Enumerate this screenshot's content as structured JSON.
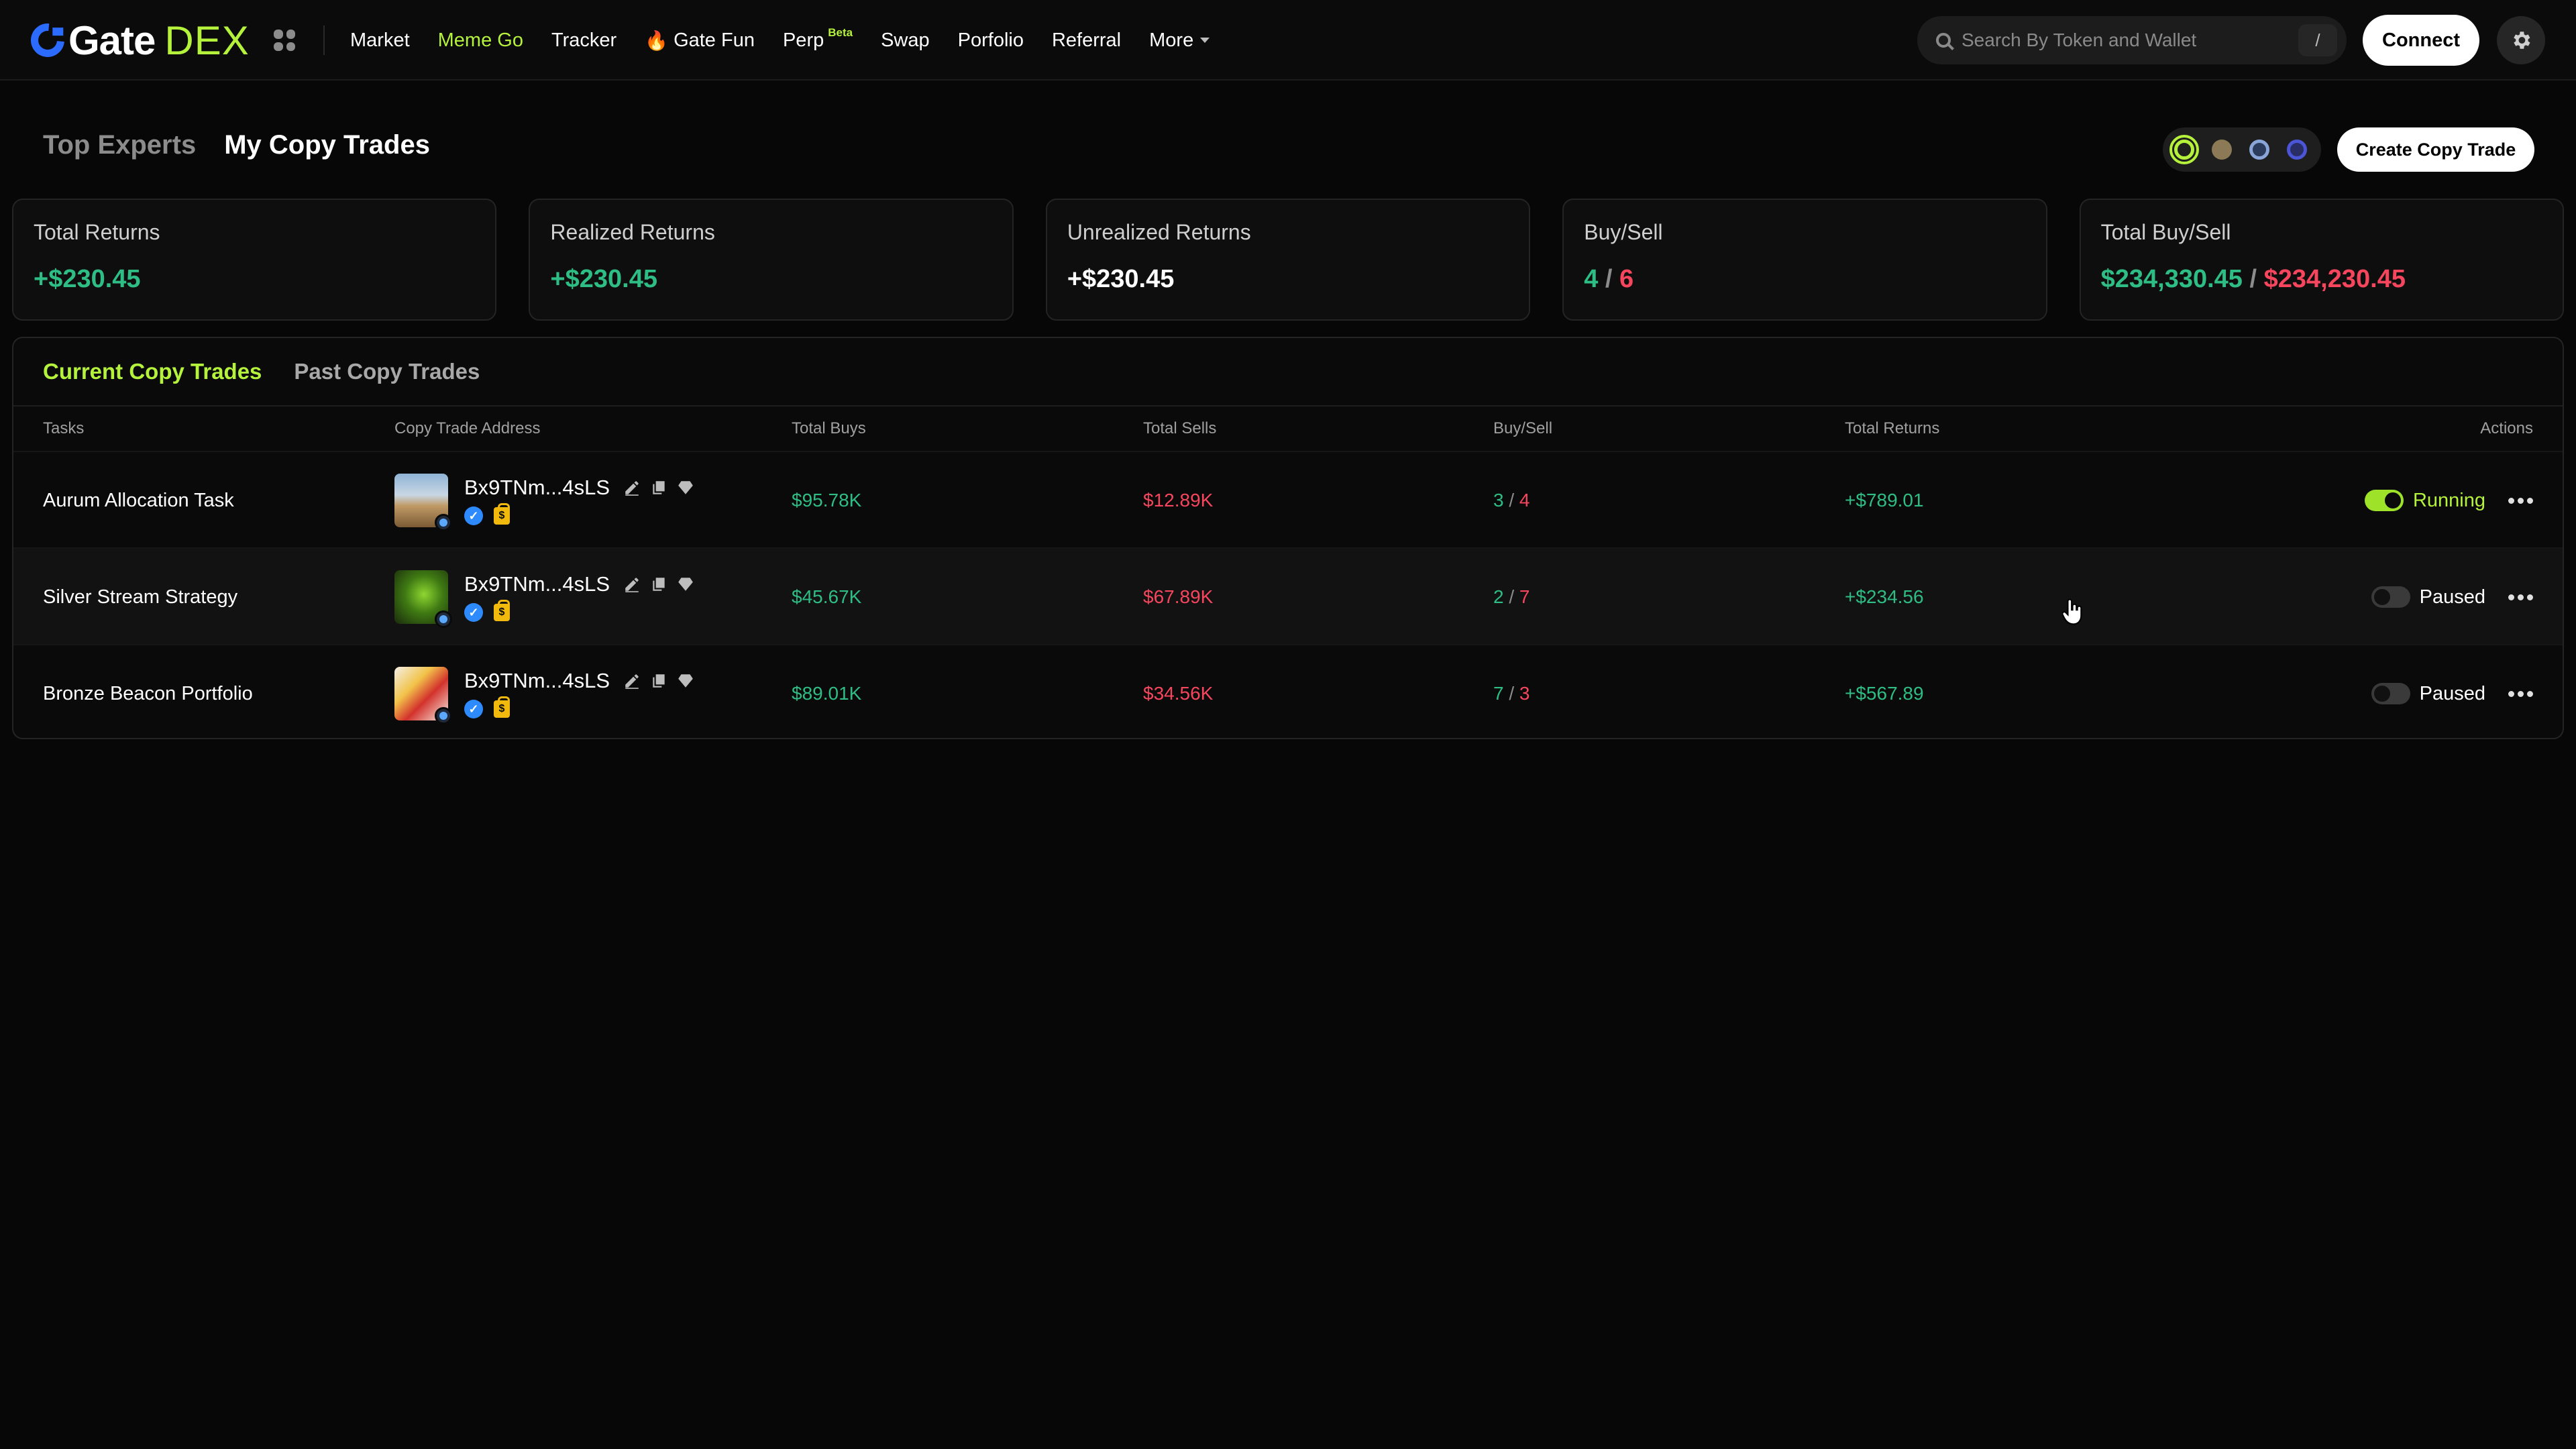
{
  "header": {
    "logo_gate": "Gate",
    "logo_dex": "DEX",
    "nav": [
      {
        "label": "Market",
        "active": false
      },
      {
        "label": "Meme Go",
        "active": true
      },
      {
        "label": "Tracker",
        "active": false
      },
      {
        "label": "Gate Fun",
        "active": false,
        "icon": "fire-icon"
      },
      {
        "label": "Perp",
        "active": false,
        "badge": "Beta"
      },
      {
        "label": "Swap",
        "active": false
      },
      {
        "label": "Porfolio",
        "active": false
      },
      {
        "label": "Referral",
        "active": false
      },
      {
        "label": "More",
        "active": false,
        "icon": "caret-down-icon"
      }
    ],
    "search_placeholder": "Search By Token and Wallet",
    "search_shortcut": "/",
    "connect_label": "Connect",
    "settings_icon": "gear-icon"
  },
  "page_tabs": [
    {
      "label": "Top Experts",
      "active": false
    },
    {
      "label": "My Copy Trades",
      "active": true
    }
  ],
  "chain_selector": {
    "chains": [
      {
        "icon": "solana-icon",
        "color": "#b5f23c",
        "selected": true
      },
      {
        "icon": "bnb-icon",
        "color": "#8b7a55",
        "selected": false
      },
      {
        "icon": "base-icon",
        "color": "#8aa6d8",
        "selected": false
      },
      {
        "icon": "ethereum-icon",
        "color": "#4a56d6",
        "selected": false
      }
    ]
  },
  "create_button_label": "Create Copy Trade",
  "stats": {
    "total_returns": {
      "label": "Total Returns",
      "value": "+$230.45"
    },
    "realized_returns": {
      "label": "Realized Returns",
      "value": "+$230.45"
    },
    "unrealized_returns": {
      "label": "Unrealized Returns",
      "value": "+$230.45"
    },
    "buy_sell": {
      "label": "Buy/Sell",
      "buy": "4",
      "sep": " / ",
      "sell": "6"
    },
    "total_buy_sell": {
      "label": "Total Buy/Sell",
      "buy": "$234,330.45",
      "sep": " / ",
      "sell": "$234,230.45"
    }
  },
  "sub_tabs": [
    {
      "label": "Current Copy Trades",
      "active": true
    },
    {
      "label": "Past Copy Trades",
      "active": false
    }
  ],
  "table": {
    "columns": [
      "Tasks",
      "Copy Trade Address",
      "Total Buys",
      "Total Sells",
      "Buy/Sell",
      "Total Returns",
      "Actions"
    ],
    "rows": [
      {
        "task": "Aurum Allocation Task",
        "address": "Bx9TNm...4sLS",
        "total_buys": "$95.78K",
        "total_sells": "$12.89K",
        "buys": "3",
        "sells": "4",
        "total_returns": "+$789.01",
        "status": "Running",
        "enabled": true
      },
      {
        "task": "Silver Stream Strategy",
        "address": "Bx9TNm...4sLS",
        "total_buys": "$45.67K",
        "total_sells": "$67.89K",
        "buys": "2",
        "sells": "7",
        "total_returns": "+$234.56",
        "status": "Paused",
        "enabled": false
      },
      {
        "task": "Bronze Beacon Portfolio",
        "address": "Bx9TNm...4sLS",
        "total_buys": "$89.01K",
        "total_sells": "$34.56K",
        "buys": "7",
        "sells": "3",
        "total_returns": "+$567.89",
        "status": "Paused",
        "enabled": false
      }
    ]
  },
  "colors": {
    "accent": "#b5f23c",
    "positive": "#2ebd85",
    "negative": "#f6465d",
    "background": "#070707"
  }
}
